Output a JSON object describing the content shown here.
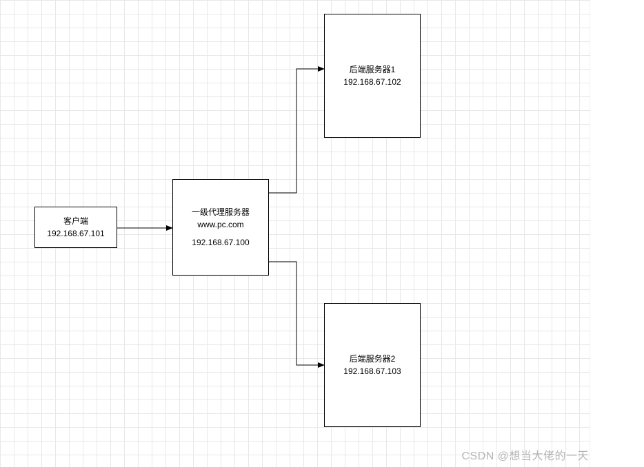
{
  "meta": {
    "watermark": "CSDN @想当大佬的一天"
  },
  "nodes": {
    "client": {
      "title": "客户端",
      "ip": "192.168.67.101"
    },
    "proxy": {
      "title": "一级代理服务器",
      "domain": "www.pc.com",
      "ip": "192.168.67.100"
    },
    "backend1": {
      "title": "后端服务器1",
      "ip": "192.168.67.102"
    },
    "backend2": {
      "title": "后端服务器2",
      "ip": "192.168.67.103"
    }
  },
  "edges": [
    {
      "from": "client",
      "to": "proxy"
    },
    {
      "from": "proxy",
      "to": "backend1"
    },
    {
      "from": "proxy",
      "to": "backend2"
    }
  ]
}
